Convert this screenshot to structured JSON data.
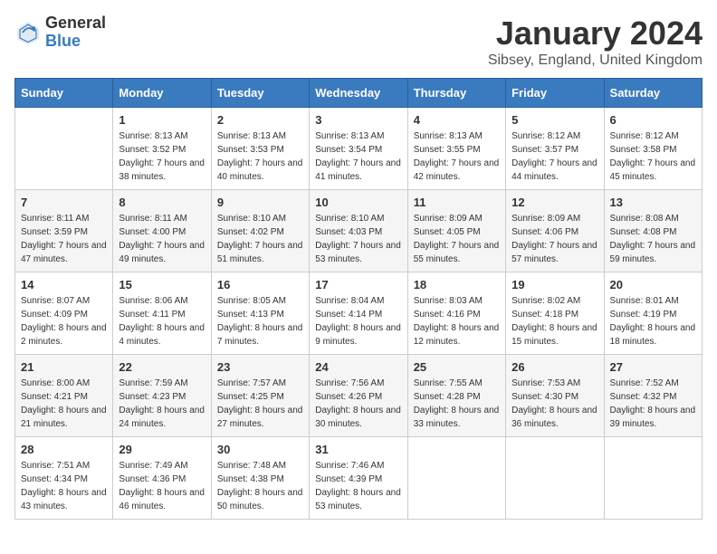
{
  "header": {
    "logo_general": "General",
    "logo_blue": "Blue",
    "month_title": "January 2024",
    "location": "Sibsey, England, United Kingdom"
  },
  "weekdays": [
    "Sunday",
    "Monday",
    "Tuesday",
    "Wednesday",
    "Thursday",
    "Friday",
    "Saturday"
  ],
  "weeks": [
    [
      {
        "day": null,
        "sunrise": null,
        "sunset": null,
        "daylight": null
      },
      {
        "day": "1",
        "sunrise": "8:13 AM",
        "sunset": "3:52 PM",
        "daylight": "7 hours and 38 minutes."
      },
      {
        "day": "2",
        "sunrise": "8:13 AM",
        "sunset": "3:53 PM",
        "daylight": "7 hours and 40 minutes."
      },
      {
        "day": "3",
        "sunrise": "8:13 AM",
        "sunset": "3:54 PM",
        "daylight": "7 hours and 41 minutes."
      },
      {
        "day": "4",
        "sunrise": "8:13 AM",
        "sunset": "3:55 PM",
        "daylight": "7 hours and 42 minutes."
      },
      {
        "day": "5",
        "sunrise": "8:12 AM",
        "sunset": "3:57 PM",
        "daylight": "7 hours and 44 minutes."
      },
      {
        "day": "6",
        "sunrise": "8:12 AM",
        "sunset": "3:58 PM",
        "daylight": "7 hours and 45 minutes."
      }
    ],
    [
      {
        "day": "7",
        "sunrise": "8:11 AM",
        "sunset": "3:59 PM",
        "daylight": "7 hours and 47 minutes."
      },
      {
        "day": "8",
        "sunrise": "8:11 AM",
        "sunset": "4:00 PM",
        "daylight": "7 hours and 49 minutes."
      },
      {
        "day": "9",
        "sunrise": "8:10 AM",
        "sunset": "4:02 PM",
        "daylight": "7 hours and 51 minutes."
      },
      {
        "day": "10",
        "sunrise": "8:10 AM",
        "sunset": "4:03 PM",
        "daylight": "7 hours and 53 minutes."
      },
      {
        "day": "11",
        "sunrise": "8:09 AM",
        "sunset": "4:05 PM",
        "daylight": "7 hours and 55 minutes."
      },
      {
        "day": "12",
        "sunrise": "8:09 AM",
        "sunset": "4:06 PM",
        "daylight": "7 hours and 57 minutes."
      },
      {
        "day": "13",
        "sunrise": "8:08 AM",
        "sunset": "4:08 PM",
        "daylight": "7 hours and 59 minutes."
      }
    ],
    [
      {
        "day": "14",
        "sunrise": "8:07 AM",
        "sunset": "4:09 PM",
        "daylight": "8 hours and 2 minutes."
      },
      {
        "day": "15",
        "sunrise": "8:06 AM",
        "sunset": "4:11 PM",
        "daylight": "8 hours and 4 minutes."
      },
      {
        "day": "16",
        "sunrise": "8:05 AM",
        "sunset": "4:13 PM",
        "daylight": "8 hours and 7 minutes."
      },
      {
        "day": "17",
        "sunrise": "8:04 AM",
        "sunset": "4:14 PM",
        "daylight": "8 hours and 9 minutes."
      },
      {
        "day": "18",
        "sunrise": "8:03 AM",
        "sunset": "4:16 PM",
        "daylight": "8 hours and 12 minutes."
      },
      {
        "day": "19",
        "sunrise": "8:02 AM",
        "sunset": "4:18 PM",
        "daylight": "8 hours and 15 minutes."
      },
      {
        "day": "20",
        "sunrise": "8:01 AM",
        "sunset": "4:19 PM",
        "daylight": "8 hours and 18 minutes."
      }
    ],
    [
      {
        "day": "21",
        "sunrise": "8:00 AM",
        "sunset": "4:21 PM",
        "daylight": "8 hours and 21 minutes."
      },
      {
        "day": "22",
        "sunrise": "7:59 AM",
        "sunset": "4:23 PM",
        "daylight": "8 hours and 24 minutes."
      },
      {
        "day": "23",
        "sunrise": "7:57 AM",
        "sunset": "4:25 PM",
        "daylight": "8 hours and 27 minutes."
      },
      {
        "day": "24",
        "sunrise": "7:56 AM",
        "sunset": "4:26 PM",
        "daylight": "8 hours and 30 minutes."
      },
      {
        "day": "25",
        "sunrise": "7:55 AM",
        "sunset": "4:28 PM",
        "daylight": "8 hours and 33 minutes."
      },
      {
        "day": "26",
        "sunrise": "7:53 AM",
        "sunset": "4:30 PM",
        "daylight": "8 hours and 36 minutes."
      },
      {
        "day": "27",
        "sunrise": "7:52 AM",
        "sunset": "4:32 PM",
        "daylight": "8 hours and 39 minutes."
      }
    ],
    [
      {
        "day": "28",
        "sunrise": "7:51 AM",
        "sunset": "4:34 PM",
        "daylight": "8 hours and 43 minutes."
      },
      {
        "day": "29",
        "sunrise": "7:49 AM",
        "sunset": "4:36 PM",
        "daylight": "8 hours and 46 minutes."
      },
      {
        "day": "30",
        "sunrise": "7:48 AM",
        "sunset": "4:38 PM",
        "daylight": "8 hours and 50 minutes."
      },
      {
        "day": "31",
        "sunrise": "7:46 AM",
        "sunset": "4:39 PM",
        "daylight": "8 hours and 53 minutes."
      },
      {
        "day": null,
        "sunrise": null,
        "sunset": null,
        "daylight": null
      },
      {
        "day": null,
        "sunrise": null,
        "sunset": null,
        "daylight": null
      },
      {
        "day": null,
        "sunrise": null,
        "sunset": null,
        "daylight": null
      }
    ]
  ],
  "labels": {
    "sunrise_prefix": "Sunrise: ",
    "sunset_prefix": "Sunset: ",
    "daylight_prefix": "Daylight: "
  }
}
